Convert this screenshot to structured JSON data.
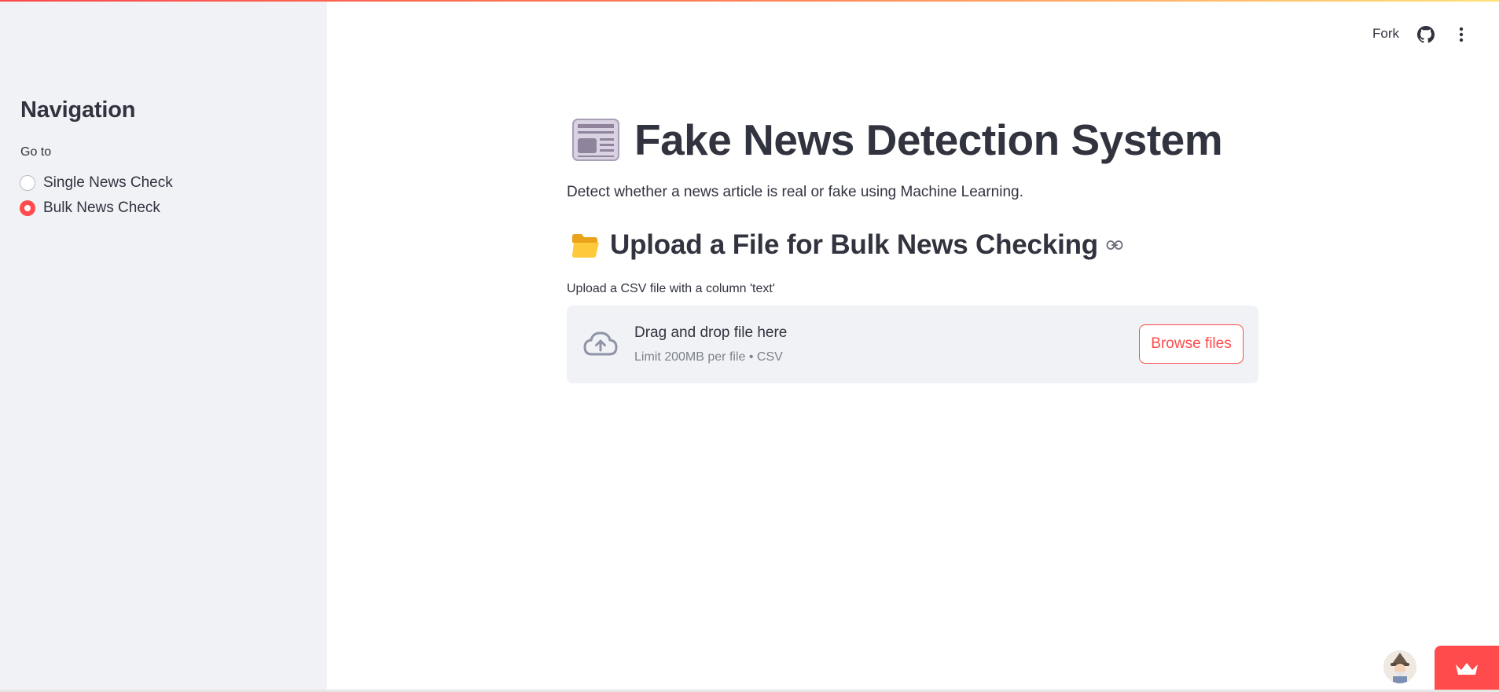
{
  "header": {
    "fork_label": "Fork",
    "github_icon": "github-icon",
    "menu_icon": "kebab-menu-icon",
    "accent_gradient": [
      "#ff4b4b",
      "#ff8a5b",
      "#ffe17a"
    ]
  },
  "sidebar": {
    "title": "Navigation",
    "radio_group_label": "Go to",
    "options": [
      {
        "label": "Single News Check",
        "selected": false
      },
      {
        "label": "Bulk News Check",
        "selected": true
      }
    ],
    "background": "#f0f2f6"
  },
  "main": {
    "title_icon": "newspaper-icon",
    "title": "Fake News Detection System",
    "subtitle": "Detect whether a news article is real or fake using Machine Learning.",
    "section_icon": "open-folder-icon",
    "section_title": "Upload a File for Bulk News Checking",
    "section_link_icon": "link-icon",
    "uploader": {
      "label": "Upload a CSV file with a column 'text'",
      "drop_text": "Drag and drop file here",
      "limit_text": "Limit 200MB per file • CSV",
      "browse_label": "Browse files",
      "icon": "cloud-upload-icon"
    }
  },
  "footer": {
    "avatar_icon": "wizard-avatar-icon",
    "crown_icon": "crown-icon"
  },
  "colors": {
    "accent": "#ff4b4b",
    "text": "#31333f",
    "muted": "#7d818b"
  }
}
